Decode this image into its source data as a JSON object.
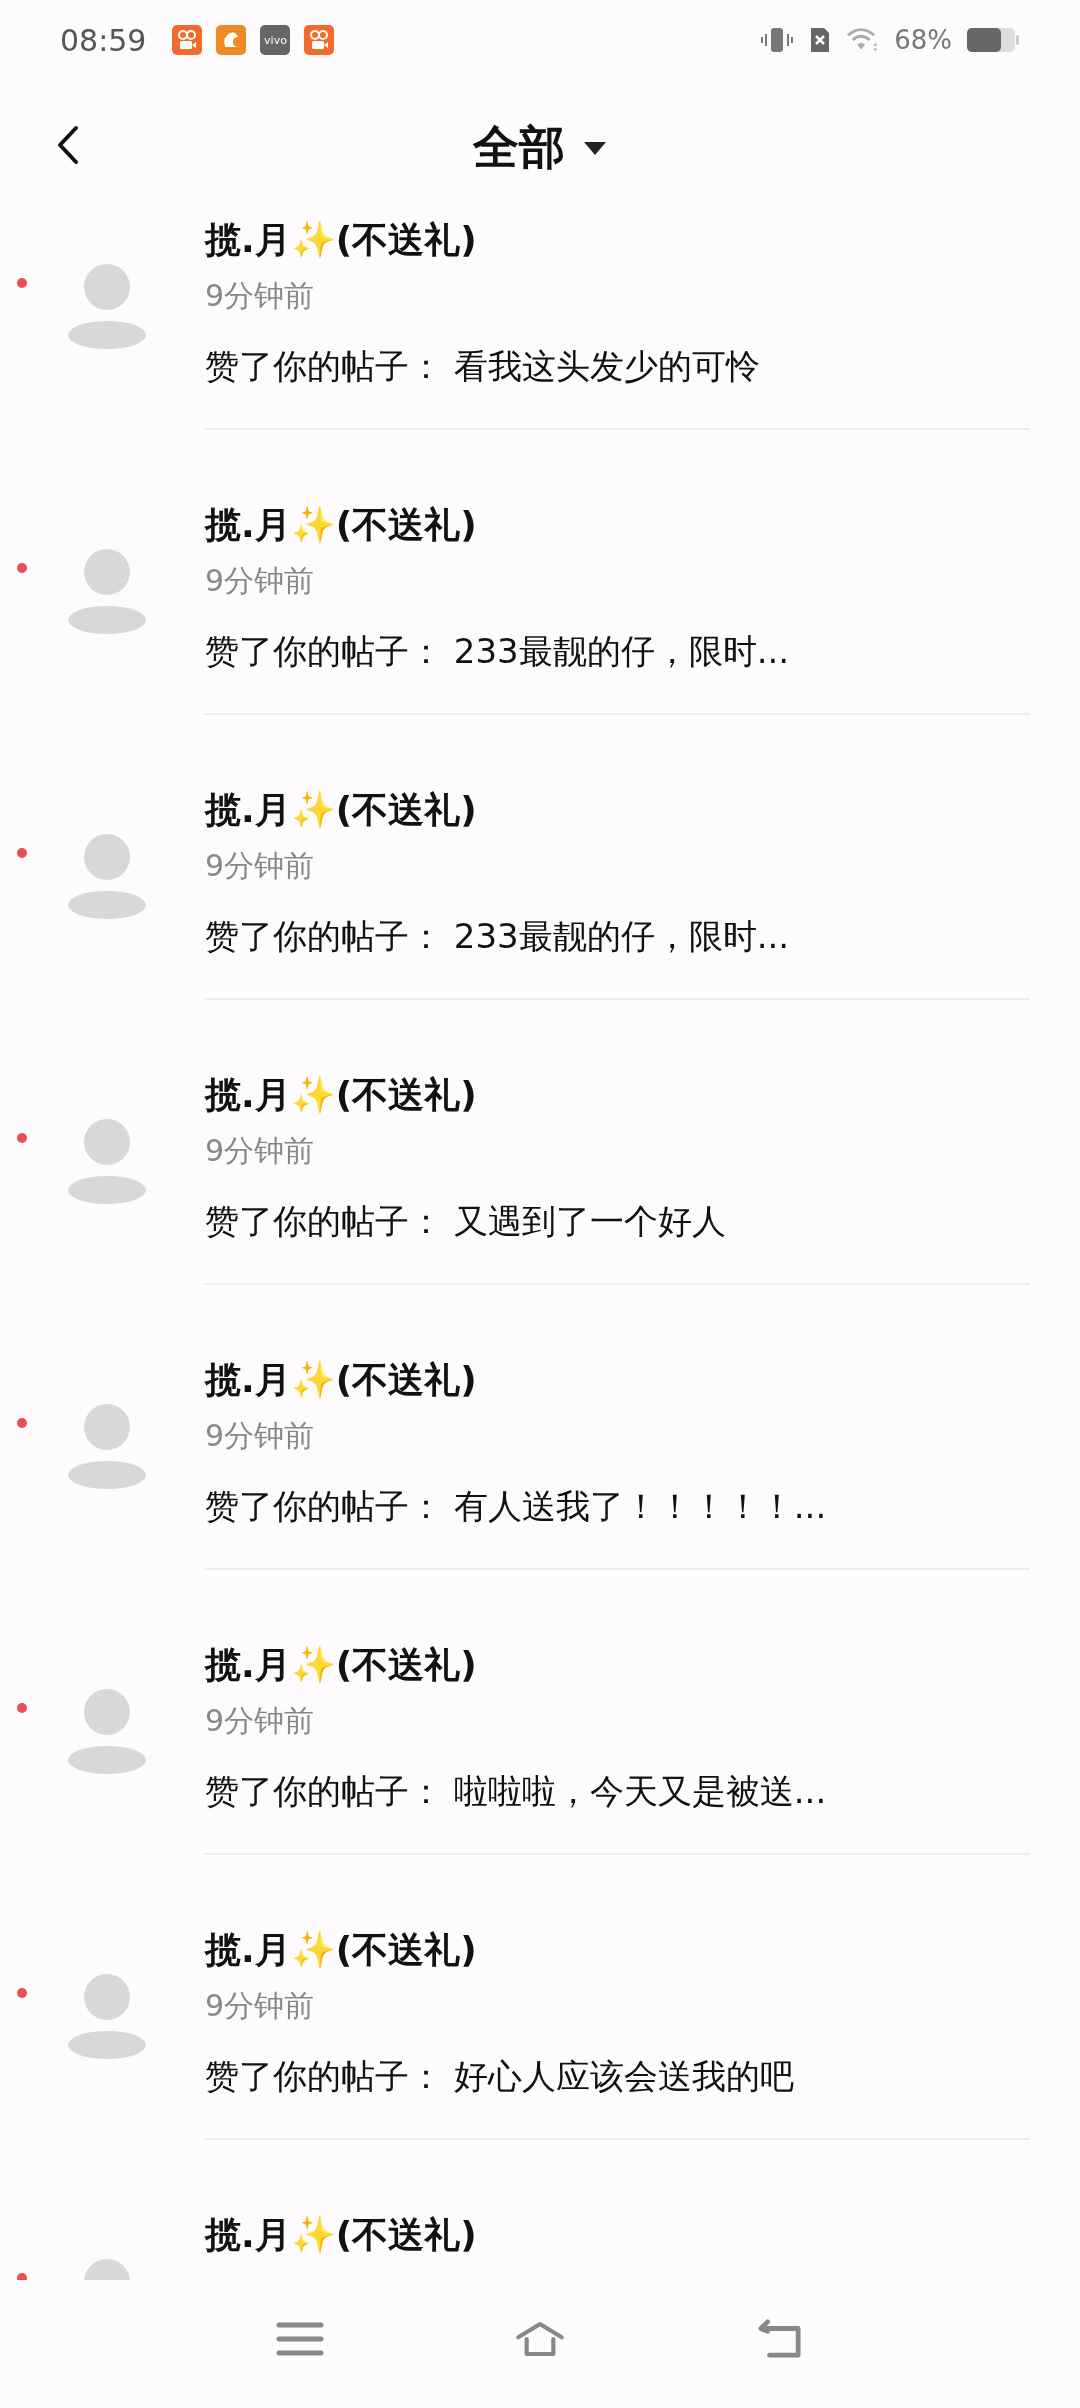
{
  "status_bar": {
    "time": "08:59",
    "notification_icons": [
      {
        "kind": "video"
      },
      {
        "kind": "squirrel"
      },
      {
        "kind": "vivo",
        "label": "vivo"
      },
      {
        "kind": "video"
      }
    ],
    "battery_text": "68%"
  },
  "header": {
    "title": "全部"
  },
  "notifications": [
    {
      "name": "揽.月✨(不送礼)",
      "time": "9分钟前",
      "message": "赞了你的帖子：  看我这头发少的可怜",
      "unread": true
    },
    {
      "name": "揽.月✨(不送礼)",
      "time": "9分钟前",
      "message": "赞了你的帖子：  233最靓的仔，限时...",
      "unread": true
    },
    {
      "name": "揽.月✨(不送礼)",
      "time": "9分钟前",
      "message": "赞了你的帖子：  233最靓的仔，限时...",
      "unread": true
    },
    {
      "name": "揽.月✨(不送礼)",
      "time": "9分钟前",
      "message": "赞了你的帖子：  又遇到了一个好人",
      "unread": true
    },
    {
      "name": "揽.月✨(不送礼)",
      "time": "9分钟前",
      "message": "赞了你的帖子：  有人送我了！！！！！...",
      "unread": true
    },
    {
      "name": "揽.月✨(不送礼)",
      "time": "9分钟前",
      "message": "赞了你的帖子：  啦啦啦，今天又是被送...",
      "unread": true
    },
    {
      "name": "揽.月✨(不送礼)",
      "time": "9分钟前",
      "message": "赞了你的帖子：  好心人应该会送我的吧",
      "unread": true
    },
    {
      "name": "揽.月✨(不送礼)",
      "unread": true
    }
  ]
}
